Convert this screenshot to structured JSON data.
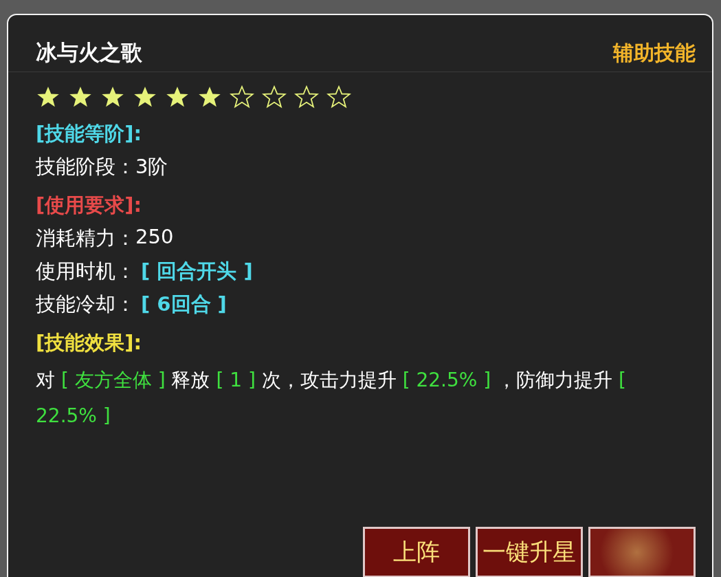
{
  "title": "冰与火之歌",
  "category": "辅助技能",
  "stars": [
    {
      "filled": true
    },
    {
      "filled": true
    },
    {
      "filled": true
    },
    {
      "filled": true
    },
    {
      "filled": true
    },
    {
      "filled": true
    },
    {
      "filled": false
    },
    {
      "filled": false
    },
    {
      "filled": false
    },
    {
      "filled": false
    }
  ],
  "sections": [
    {
      "heading": "[技能等阶]:",
      "color": "#4fd8e8",
      "rows": [
        {
          "label": "技能阶段：",
          "value": "3阶",
          "kind": "plain"
        }
      ]
    },
    {
      "heading": "[使用要求]:",
      "color": "#e84a4a",
      "rows": [
        {
          "label": "消耗精力：",
          "value": "250",
          "kind": "plain"
        },
        {
          "label": "使用时机：",
          "value": "[ 回合开头 ]",
          "kind": "bracket"
        },
        {
          "label": "技能冷却：",
          "value": "[ 6回合 ]",
          "kind": "bracket"
        }
      ]
    },
    {
      "heading": "[技能效果]:",
      "color": "#f0e040",
      "effect": [
        {
          "text": "对 ",
          "kind": "plain"
        },
        {
          "text": "[ 友方全体 ]",
          "kind": "value"
        },
        {
          "text": " 释放 ",
          "kind": "plain"
        },
        {
          "text": "[ 1 ]",
          "kind": "value"
        },
        {
          "text": " 次，攻击力提升 ",
          "kind": "plain"
        },
        {
          "text": "[ 22.5% ]",
          "kind": "value"
        },
        {
          "text": " ，防御力提升 ",
          "kind": "plain"
        },
        {
          "text": "[ 22.5% ]",
          "kind": "value"
        }
      ]
    }
  ],
  "buttons": [
    {
      "label": "上阵",
      "kind": "text"
    },
    {
      "label": "一键升星",
      "kind": "text"
    },
    {
      "kind": "blurred"
    }
  ]
}
